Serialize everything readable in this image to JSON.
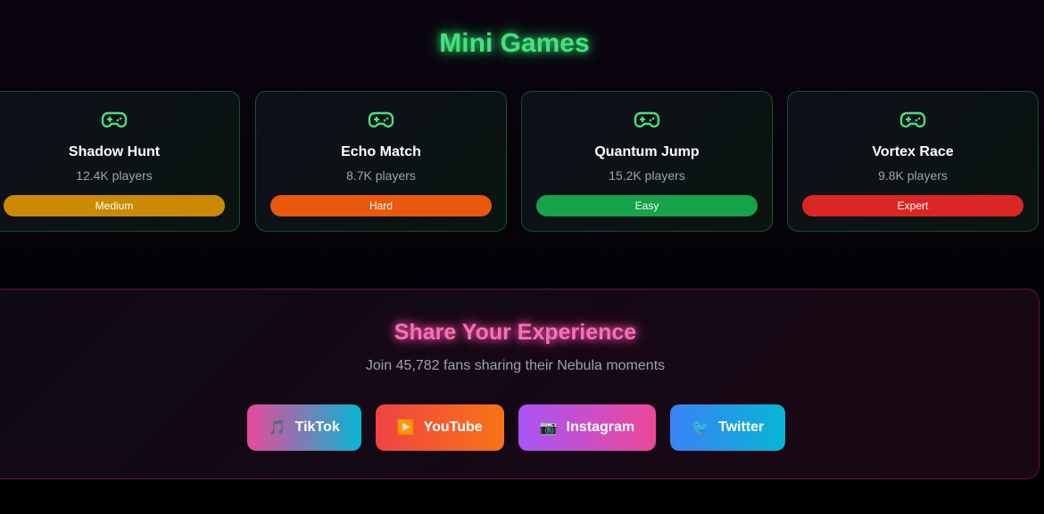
{
  "header": {
    "title": "Mini Games"
  },
  "games": [
    {
      "name": "Shadow Hunt",
      "players": "12.4K players",
      "difficulty": "Medium",
      "color": "#ca8a04"
    },
    {
      "name": "Echo Match",
      "players": "8.7K players",
      "difficulty": "Hard",
      "color": "#ea580c"
    },
    {
      "name": "Quantum Jump",
      "players": "15.2K players",
      "difficulty": "Easy",
      "color": "#16a34a"
    },
    {
      "name": "Vortex Race",
      "players": "9.8K players",
      "difficulty": "Expert",
      "color": "#dc2626"
    }
  ],
  "share": {
    "title": "Share Your Experience",
    "subtitle": "Join 45,782 fans sharing their Nebula moments",
    "buttons": [
      {
        "label": "TikTok",
        "icon": "🎵",
        "gradient": "linear-gradient(90deg,#ec4899,#06b6d4)"
      },
      {
        "label": "YouTube",
        "icon": "▶️",
        "gradient": "linear-gradient(90deg,#ef4444,#f97316)"
      },
      {
        "label": "Instagram",
        "icon": "📷",
        "gradient": "linear-gradient(90deg,#a855f7,#ec4899)"
      },
      {
        "label": "Twitter",
        "icon": "🐦",
        "gradient": "linear-gradient(90deg,#3b82f6,#06b6d4)"
      }
    ]
  }
}
